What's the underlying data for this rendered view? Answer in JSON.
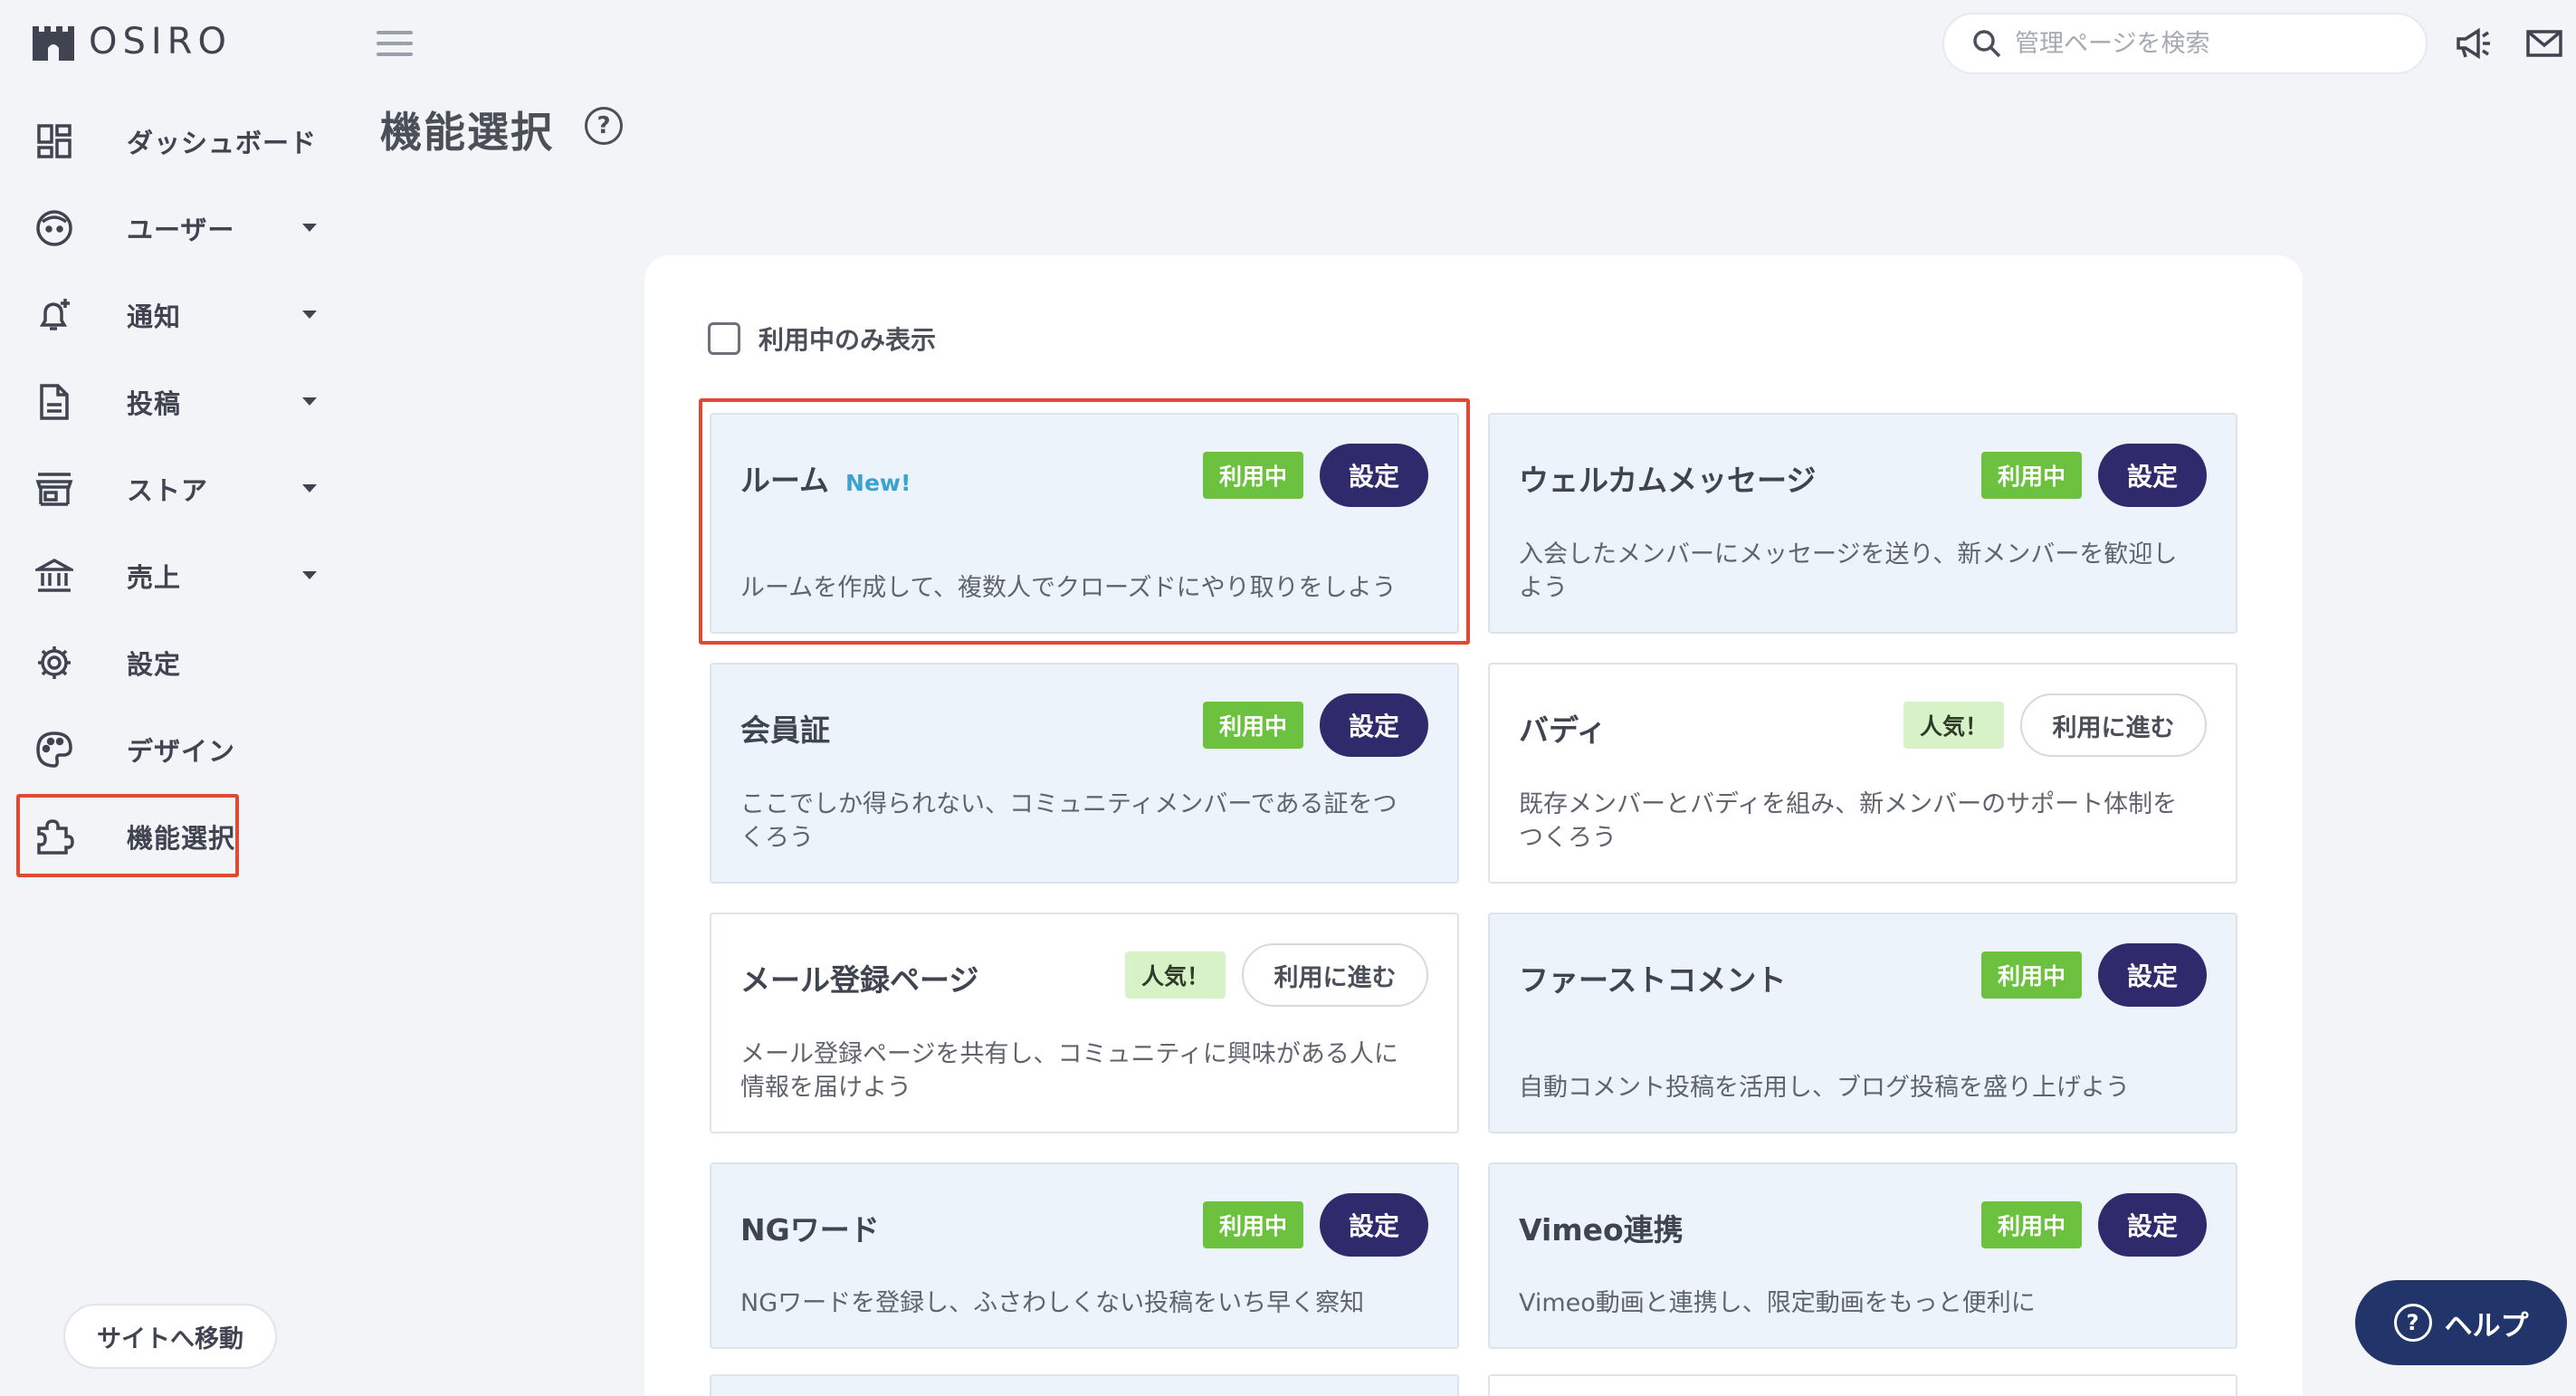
{
  "brand": {
    "name": "OSIRO"
  },
  "sidebar": {
    "items": [
      {
        "label": "ダッシュボード",
        "icon": "dashboard-icon",
        "caret": false
      },
      {
        "label": "ユーザー",
        "icon": "user-face-icon",
        "caret": true
      },
      {
        "label": "通知",
        "icon": "bell-plus-icon",
        "caret": true
      },
      {
        "label": "投稿",
        "icon": "document-icon",
        "caret": true
      },
      {
        "label": "ストア",
        "icon": "store-icon",
        "caret": true
      },
      {
        "label": "売上",
        "icon": "bank-icon",
        "caret": true
      },
      {
        "label": "設定",
        "icon": "gear-icon",
        "caret": false
      },
      {
        "label": "デザイン",
        "icon": "palette-icon",
        "caret": false
      },
      {
        "label": "機能選択",
        "icon": "puzzle-icon",
        "caret": false,
        "active": true
      }
    ],
    "site_button": "サイトへ移動"
  },
  "header": {
    "search_placeholder": "管理ページを検索"
  },
  "page": {
    "title": "機能選択",
    "help_glyph": "?",
    "filter_label": "利用中のみ表示"
  },
  "cards": [
    {
      "title": "ルーム",
      "new": "New!",
      "status": "利用中",
      "action": "設定",
      "in_use": true,
      "desc": "ルームを作成して、複数人でクローズドにやり取りをしよう"
    },
    {
      "title": "ウェルカムメッセージ",
      "status": "利用中",
      "action": "設定",
      "in_use": true,
      "desc": "入会したメンバーにメッセージを送り、新メンバーを歓迎しよう"
    },
    {
      "title": "会員証",
      "status": "利用中",
      "action": "設定",
      "in_use": true,
      "desc": "ここでしか得られない、コミュニティメンバーである証をつくろう"
    },
    {
      "title": "バディ",
      "status": "人気！",
      "action": "利用に進む",
      "in_use": false,
      "desc": "既存メンバーとバディを組み、新メンバーのサポート体制をつくろう"
    },
    {
      "title": "メール登録ページ",
      "status": "人気！",
      "action": "利用に進む",
      "in_use": false,
      "desc": "メール登録ページを共有し、コミュニティに興味がある人に情報を届けよう"
    },
    {
      "title": "ファーストコメント",
      "status": "利用中",
      "action": "設定",
      "in_use": true,
      "desc": "自動コメント投稿を活用し、ブログ投稿を盛り上げよう"
    },
    {
      "title": "NGワード",
      "status": "利用中",
      "action": "設定",
      "in_use": true,
      "desc": "NGワードを登録し、ふさわしくない投稿をいち早く察知"
    },
    {
      "title": "Vimeo連携",
      "status": "利用中",
      "action": "設定",
      "in_use": true,
      "desc": "Vimeo動画と連携し、限定動画をもっと便利に"
    }
  ],
  "help_fab": {
    "label": "ヘルプ",
    "glyph": "?"
  },
  "colors": {
    "accent_navy": "#2e2a6b",
    "in_use_green": "#6cc13f",
    "highlight_red": "#e04a35",
    "help_blue": "#22356b"
  }
}
